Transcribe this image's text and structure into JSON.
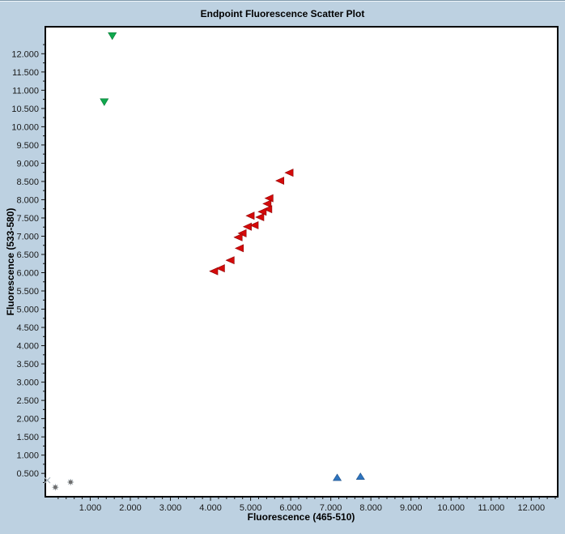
{
  "window": {
    "background": "#BDD1E1"
  },
  "colors": {
    "plot_background": "#FFFFFF",
    "plot_border": "#000000",
    "tick_color": "#111111",
    "text_color": "#1A1A1A",
    "title_color": "#000000"
  },
  "chart_data": {
    "type": "scatter",
    "title": "Endpoint Fluorescence Scatter Plot",
    "xlabel": "Fluorescence (465-510)",
    "ylabel": "Fluorescence (533-580)",
    "xlim": [
      -0.12,
      12.66
    ],
    "ylim": [
      -0.14,
      12.74
    ],
    "grid": false,
    "legend": "none",
    "x_ticks": {
      "values": [
        1,
        2,
        3,
        4,
        5,
        6,
        7,
        8,
        9,
        10,
        11,
        12
      ],
      "labels": [
        "1.000",
        "2.000",
        "3.000",
        "4.000",
        "5.000",
        "6.000",
        "7.000",
        "8.000",
        "9.000",
        "10.000",
        "11.000",
        "12.000"
      ],
      "minor_step": 0.2
    },
    "y_ticks": {
      "values": [
        0.5,
        1,
        1.5,
        2,
        2.5,
        3,
        3.5,
        4,
        4.5,
        5,
        5.5,
        6,
        6.5,
        7,
        7.5,
        8,
        8.5,
        9,
        9.5,
        10,
        10.5,
        11,
        11.5,
        12
      ],
      "labels": [
        "0.500",
        "1.000",
        "1.500",
        "2.000",
        "2.500",
        "3.000",
        "3.500",
        "4.000",
        "4.500",
        "5.000",
        "5.500",
        "6.000",
        "6.500",
        "7.000",
        "7.500",
        "8.000",
        "8.500",
        "9.000",
        "9.500",
        "10.000",
        "10.500",
        "11.000",
        "11.500",
        "12.000"
      ],
      "minor_step": 0.25
    },
    "series": [
      {
        "name": "green-triangle-down",
        "marker": "triangle-down",
        "fill": "#0FA84D",
        "stroke": "#0B7A38",
        "points": [
          [
            1.55,
            12.49
          ],
          [
            1.35,
            10.68
          ]
        ]
      },
      {
        "name": "red-triangle-left",
        "marker": "triangle-left",
        "fill": "#D40A0A",
        "stroke": "#8F0505",
        "points": [
          [
            5.97,
            8.74
          ],
          [
            5.74,
            8.52
          ],
          [
            5.47,
            8.04
          ],
          [
            5.42,
            7.89
          ],
          [
            5.44,
            7.74
          ],
          [
            5.3,
            7.67
          ],
          [
            5.24,
            7.52
          ],
          [
            5.0,
            7.56
          ],
          [
            5.1,
            7.3
          ],
          [
            4.93,
            7.26
          ],
          [
            4.8,
            7.08
          ],
          [
            4.7,
            6.97
          ],
          [
            4.73,
            6.67
          ],
          [
            4.5,
            6.34
          ],
          [
            4.26,
            6.12
          ],
          [
            4.09,
            6.04
          ]
        ]
      },
      {
        "name": "blue-triangle-up",
        "marker": "triangle-up",
        "fill": "#2E74BF",
        "stroke": "#1D4F86",
        "points": [
          [
            7.16,
            0.38
          ],
          [
            7.74,
            0.41
          ]
        ]
      },
      {
        "name": "gray-asterisk",
        "marker": "asterisk",
        "fill": "#6E6E6E",
        "stroke": "#9AA4AA",
        "points": [
          [
            0.13,
            0.12
          ],
          [
            0.51,
            0.26
          ]
        ]
      },
      {
        "name": "faint-x",
        "marker": "x",
        "fill": "none",
        "stroke": "#A9B5BD",
        "points": [
          [
            -0.07,
            0.31
          ]
        ]
      }
    ]
  }
}
